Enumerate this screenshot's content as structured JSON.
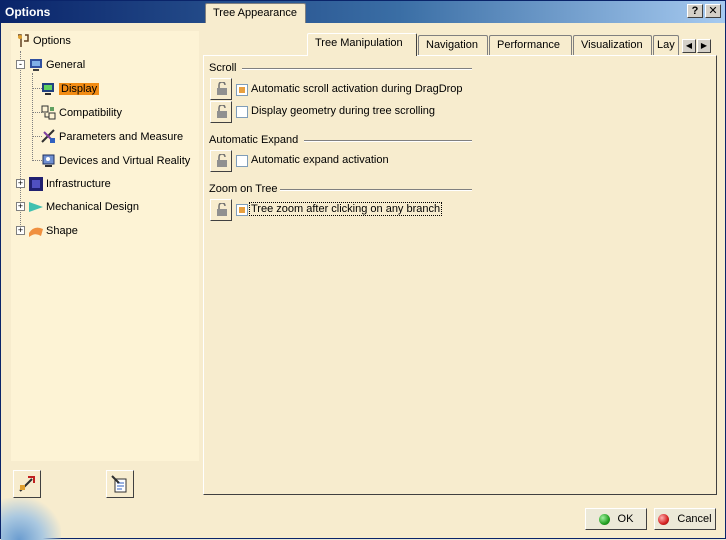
{
  "window": {
    "title": "Options",
    "help_label": "?",
    "close_label": "✕"
  },
  "tree": {
    "root": "Options",
    "items": [
      {
        "label": "General",
        "expander": "-"
      },
      {
        "label": "Display",
        "selected": true
      },
      {
        "label": "Compatibility"
      },
      {
        "label": "Parameters and Measure"
      },
      {
        "label": "Devices and Virtual Reality"
      },
      {
        "label": "Infrastructure",
        "expander": "+"
      },
      {
        "label": "Mechanical Design",
        "expander": "+"
      },
      {
        "label": "Shape",
        "expander": "+"
      }
    ]
  },
  "tabs": [
    {
      "label": "Tree Appearance"
    },
    {
      "label": "Tree Manipulation",
      "active": true
    },
    {
      "label": "Navigation"
    },
    {
      "label": "Performance"
    },
    {
      "label": "Visualization"
    },
    {
      "label": "Lay"
    }
  ],
  "tab_scroll": {
    "left": "◀",
    "right": "▶"
  },
  "groups": {
    "scroll": {
      "title": "Scroll",
      "options": [
        {
          "label": "Automatic scroll activation during DragDrop",
          "checked": true
        },
        {
          "label": "Display geometry during tree scrolling",
          "checked": false
        }
      ]
    },
    "expand": {
      "title": "Automatic Expand",
      "options": [
        {
          "label": "Automatic expand activation",
          "checked": false
        }
      ]
    },
    "zoom": {
      "title": "Zoom on Tree",
      "options": [
        {
          "label": "Tree zoom after clicking on any branch",
          "checked": true
        }
      ]
    }
  },
  "buttons": {
    "ok": "OK",
    "cancel": "Cancel"
  },
  "colors": {
    "accent": "#f28c14",
    "ok_dot": "#22a022",
    "cancel_dot": "#d42020"
  }
}
